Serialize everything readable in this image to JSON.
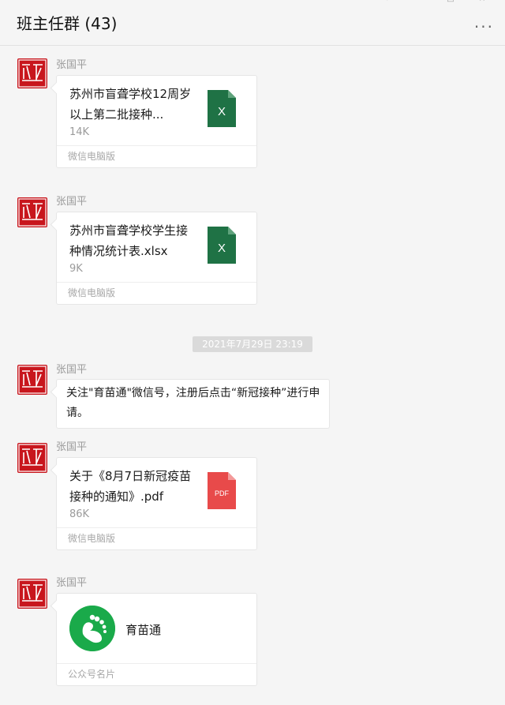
{
  "window": {
    "title": "班主任群 (43)",
    "more_label": "···"
  },
  "messages": [
    {
      "sender": "张国平",
      "file_name": "苏州市盲聋学校12周岁以上第二批接种...",
      "file_size": "14K",
      "source": "微信电脑版",
      "file_type": "xlsx",
      "icon_label": "X"
    },
    {
      "sender": "张国平",
      "file_name": "苏州市盲聋学校学生接种情况统计表.xlsx",
      "file_size": "9K",
      "source": "微信电脑版",
      "file_type": "xlsx",
      "icon_label": "X"
    },
    {
      "sender": "张国平",
      "text": "关注\"育苗通\"微信号，注册后点击“新冠接种”进行申请。"
    },
    {
      "sender": "张国平",
      "file_name": "关于《8月7日新冠疫苗接种的通知》.pdf",
      "file_size": "86K",
      "source": "微信电脑版",
      "file_type": "pdf",
      "icon_label": "PDF"
    },
    {
      "sender": "张国平",
      "biz_name": "育苗通",
      "footer": "公众号名片"
    }
  ],
  "timestamp": "2021年7月29日 23:19",
  "colors": {
    "excel": "#1f7245",
    "pdf": "#e84a4a",
    "brand_green": "#1aaa4a",
    "avatar_red": "#c8161d"
  }
}
